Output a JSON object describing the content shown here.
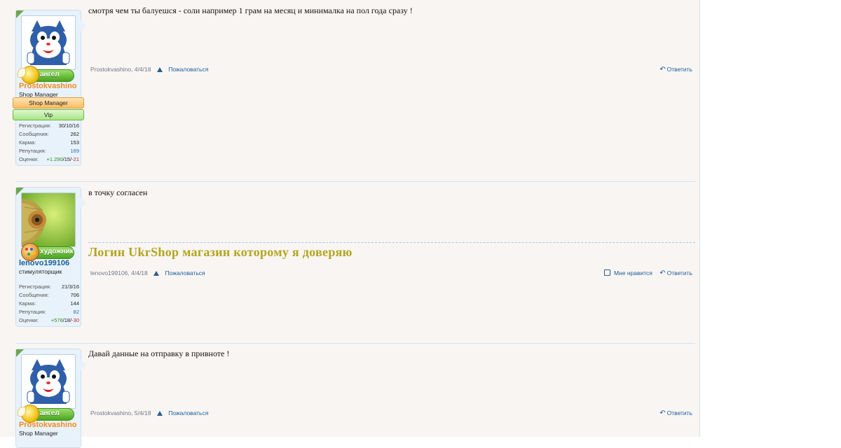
{
  "posts": [
    {
      "username": "Prostokvashino",
      "title": "Shop Manager",
      "rank_badge": "ангел",
      "banners": [
        "Shop Manager",
        "Vip"
      ],
      "stats": {
        "reg_label": "Регистрация:",
        "reg_value": "30/10/16",
        "msg_label": "Сообщения:",
        "msg_value": "262",
        "karma_label": "Карма:",
        "karma_value": "153",
        "rep_label": "Репутация:",
        "rep_value": "169",
        "ratings_label": "Оценки:",
        "ratings_pos": "+1.290",
        "ratings_neutral": "15",
        "ratings_neg": "-21"
      },
      "message": "смотря чем ты балуешся - соли например 1 грам на месяц и минималка на пол года сразу !",
      "author_meta": "Prostokvashino, 4/4/18",
      "report_label": "Пожаловаться",
      "reply_label": "Ответить"
    },
    {
      "username": "lenovo199106",
      "title": "стимуляторщик",
      "rank_badge": "художник",
      "stats": {
        "reg_label": "Регистрация:",
        "reg_value": "21/3/16",
        "msg_label": "Сообщения:",
        "msg_value": "706",
        "karma_label": "Карма:",
        "karma_value": "144",
        "rep_label": "Репутация:",
        "rep_value": "82",
        "ratings_label": "Оценки:",
        "ratings_pos": "+576",
        "ratings_neutral": "18",
        "ratings_neg": "-30"
      },
      "message": "в точку согласен",
      "signature": "Логин UkrShop магазин которому я доверяю",
      "author_meta": "lenovo199106, 4/4/18",
      "report_label": "Пожаловаться",
      "like_label": "Мне нравится",
      "reply_label": "Ответить"
    },
    {
      "username": "Prostokvashino",
      "title": "Shop Manager",
      "rank_badge": "ангел",
      "message": "Давай данные на отправку в привноте !",
      "author_meta": "Prostokvashino, 5/4/18",
      "report_label": "Пожаловаться",
      "reply_label": "Ответить"
    }
  ],
  "colors": {
    "page_bg": "#f9f5f3",
    "link_blue": "#1a5d99",
    "username_orange": "#f08a1c",
    "signature_olive": "#b3a51e",
    "positive_green": "#2d8f17",
    "negative_red": "#c0291e"
  },
  "icons": [
    "online-indicator-icon",
    "angel-rank-icon",
    "artist-rank-icon",
    "report-warning-icon",
    "reply-arrow-icon",
    "like-thumb-icon"
  ]
}
